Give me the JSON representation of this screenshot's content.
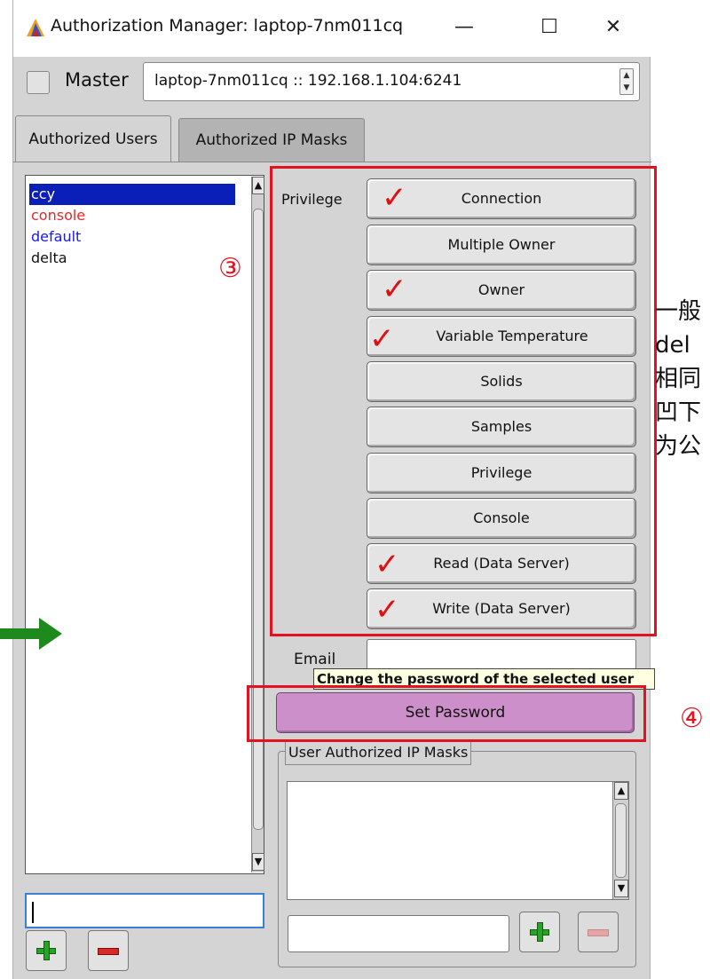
{
  "window": {
    "title": "Authorization Manager:  laptop-7nm011cq",
    "controls": {
      "minimize": "—",
      "maximize": "☐",
      "close": "✕"
    }
  },
  "master": {
    "label": "Master",
    "checked": false,
    "host": "laptop-7nm011cq :: 192.168.1.104:6241"
  },
  "tabs": [
    {
      "label": "Authorized Users",
      "active": true
    },
    {
      "label": "Authorized IP Masks",
      "active": false
    }
  ],
  "users": [
    {
      "name": "ccy",
      "color": "#ffffff",
      "selected": true
    },
    {
      "name": "console",
      "color": "#e8262a",
      "selected": false
    },
    {
      "name": "default",
      "color": "#1a1ae6",
      "selected": false
    },
    {
      "name": "delta",
      "color": "#111111",
      "selected": false
    }
  ],
  "privilege_label": "Privilege",
  "privileges": [
    {
      "label": "Connection",
      "checked": true
    },
    {
      "label": "Multiple Owner",
      "checked": false
    },
    {
      "label": "Owner",
      "checked": true
    },
    {
      "label": "Variable Temperature",
      "checked": true
    },
    {
      "label": "Solids",
      "checked": false
    },
    {
      "label": "Samples",
      "checked": false
    },
    {
      "label": "Privilege",
      "checked": false
    },
    {
      "label": "Console",
      "checked": false
    },
    {
      "label": "Read (Data Server)",
      "checked": true
    },
    {
      "label": "Write (Data Server)",
      "checked": true
    }
  ],
  "email": {
    "label": "Email",
    "value": ""
  },
  "tooltip": "Change the password of the selected user",
  "set_password_label": "Set Password",
  "ip_masks": {
    "group_title": "User Authorized IP Masks",
    "input_value": ""
  },
  "annotations": {
    "circle_3": "③",
    "circle_4": "④",
    "side_note": "一般\ndel\n相同\n凹下\n为公"
  },
  "colors": {
    "accent_red": "#e6101e",
    "selected_bg": "#0a1fb8",
    "set_password_bg": "#cd8fc9",
    "arrow_green": "#1e8a1e"
  }
}
